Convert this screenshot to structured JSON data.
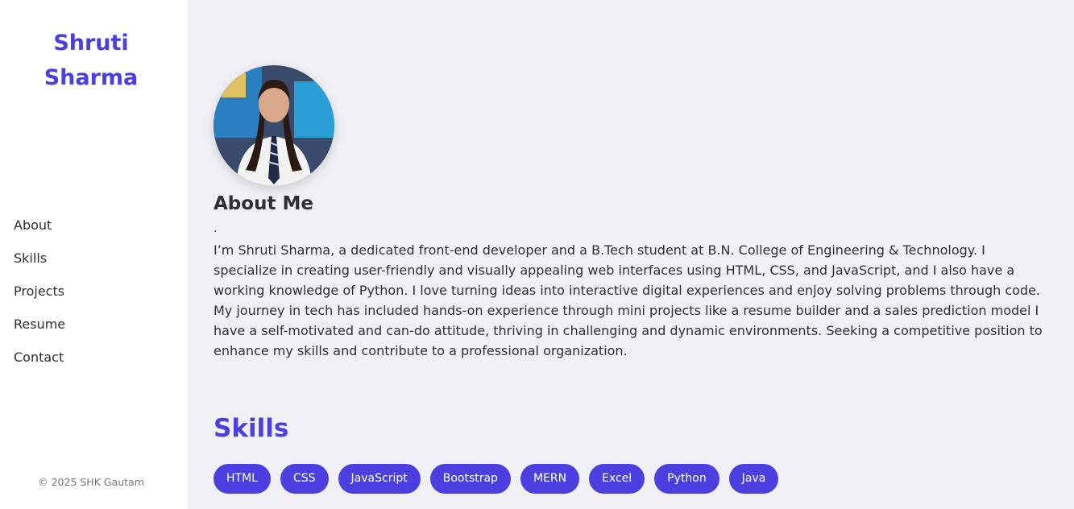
{
  "sidebar": {
    "name_line1": "Shruti",
    "name_line2": "Sharma",
    "nav": [
      "About",
      "Skills",
      "Projects",
      "Resume",
      "Contact"
    ],
    "footer": "© 2025 SHK Gautam"
  },
  "about": {
    "title": "About Me",
    "dot": ".",
    "text": "I’m Shruti Sharma, a dedicated front-end developer and a B.Tech student at B.N. College of Engineering & Technology. I specialize in creating user-friendly and visually appealing web interfaces using HTML, CSS, and JavaScript, and I also have a working knowledge of Python. I love turning ideas into interactive digital experiences and enjoy solving problems through code. My journey in tech has included hands-on experience through mini projects like a resume builder and a sales prediction model I have a self-motivated and can-do attitude, thriving in challenging and dynamic environments. Seeking a competitive position to enhance my skills and contribute to a professional organization."
  },
  "skills": {
    "title": "Skills",
    "items": [
      "HTML",
      "CSS",
      "JavaScript",
      "Bootstrap",
      "MERN",
      "Excel",
      "Python",
      "Java"
    ]
  },
  "colors": {
    "accent": "#4b3fe0",
    "page_bg": "#f0f0f5",
    "sidebar_bg": "#ffffff"
  }
}
